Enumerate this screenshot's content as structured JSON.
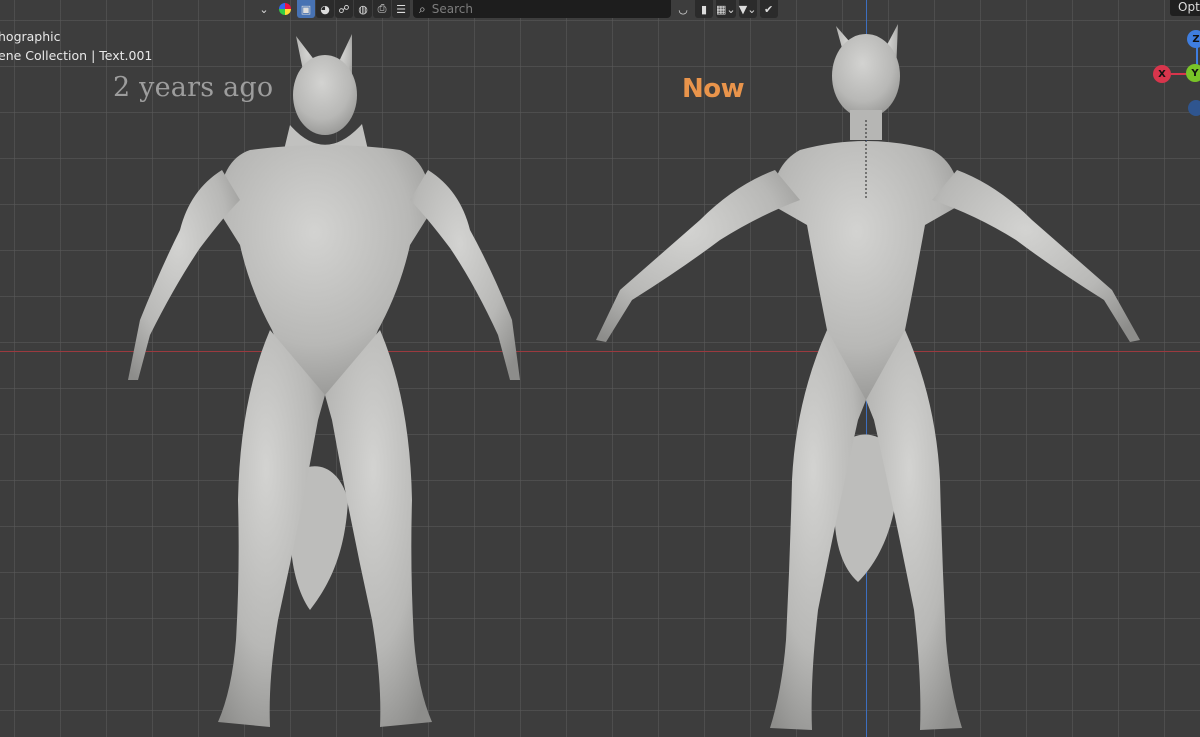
{
  "toolbar": {
    "search_placeholder": "Search",
    "options_label": "Opt"
  },
  "overlay": {
    "view_mode": "hographic",
    "collection": "ene Collection | Text.001"
  },
  "scene_labels": {
    "then": "2 years ago",
    "now": "Now"
  },
  "gizmo": {
    "z": "Z",
    "y": "Y",
    "x": "X"
  },
  "colors": {
    "grid_bg": "#3d3d3d",
    "x_axis": "#9b3a3f",
    "y_axis": "#3d6fc0",
    "now_label": "#e9944b",
    "active_button": "#4772b3"
  }
}
